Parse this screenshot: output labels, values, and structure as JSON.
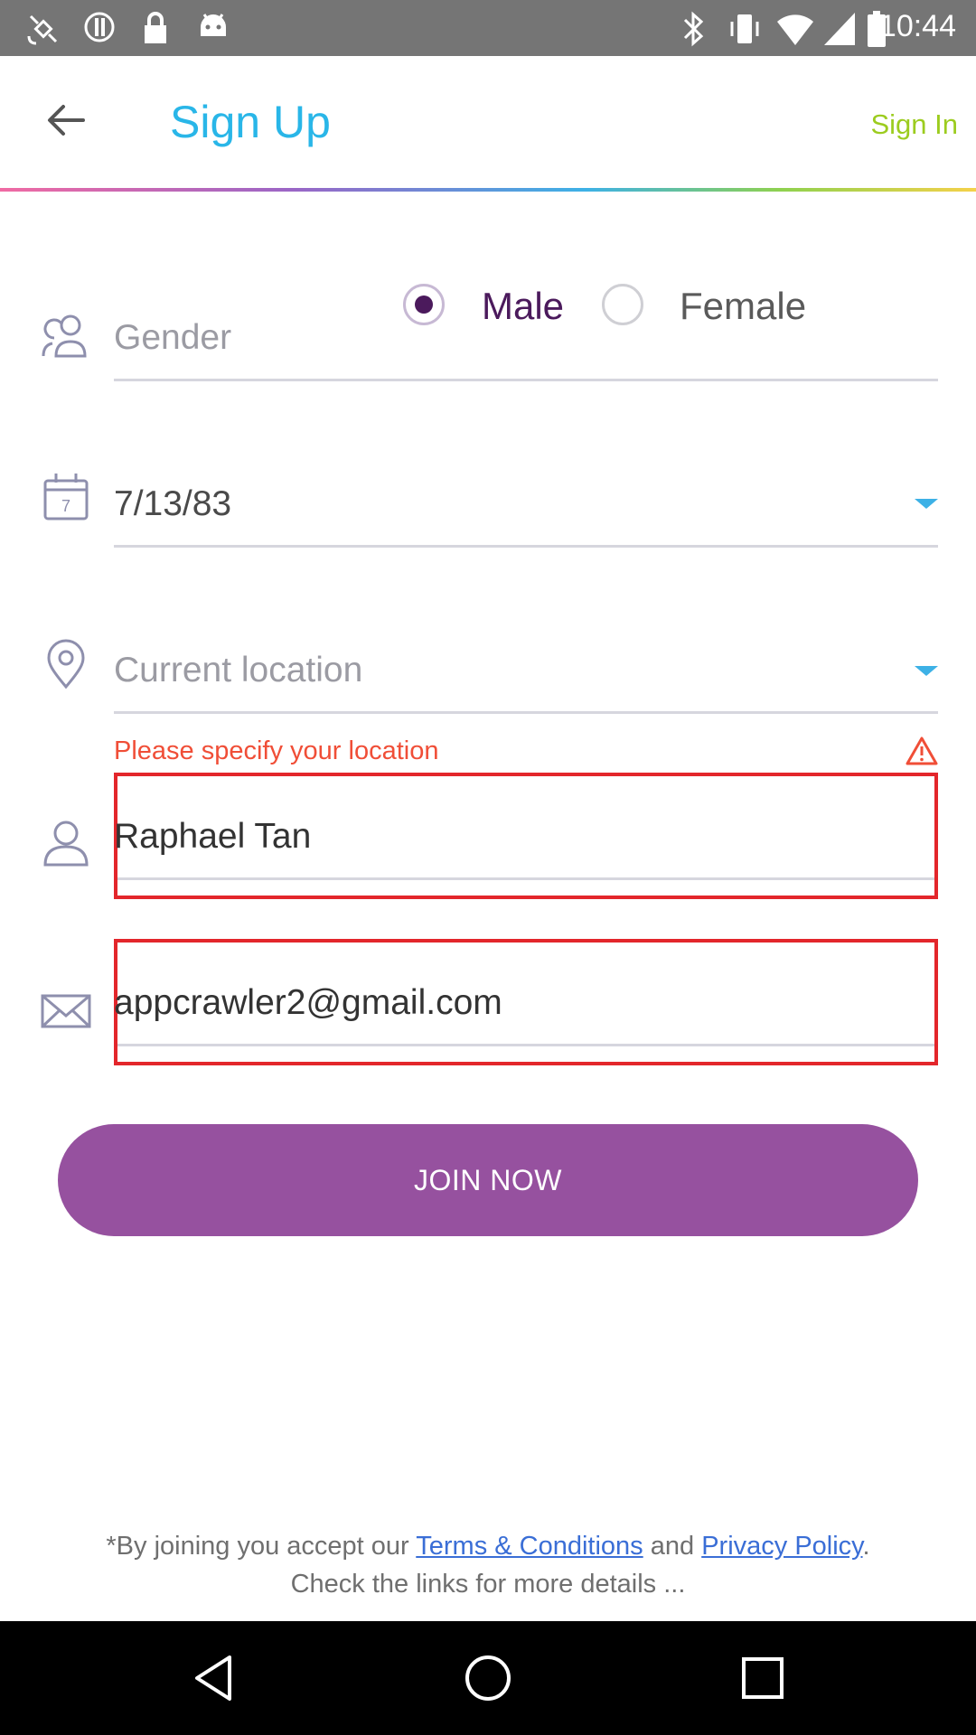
{
  "status_bar": {
    "time": "10:44"
  },
  "header": {
    "title": "Sign Up",
    "sign_in_label": "Sign In"
  },
  "form": {
    "gender": {
      "label": "Gender",
      "options": [
        {
          "label": "Male",
          "selected": true
        },
        {
          "label": "Female",
          "selected": false
        }
      ]
    },
    "birthdate": {
      "value": "7/13/83",
      "icon_day": "7"
    },
    "location": {
      "placeholder": "Current location",
      "error": "Please specify your location"
    },
    "name": {
      "value": "Raphael Tan"
    },
    "email": {
      "value": "appcrawler2@gmail.com"
    }
  },
  "join_button": {
    "label": "JOIN NOW"
  },
  "terms": {
    "prefix": "*By joining you accept our ",
    "terms_link": "Terms & Conditions",
    "middle": " and ",
    "privacy_link": "Privacy Policy",
    "suffix": ".",
    "line2": "Check the links for more details ..."
  },
  "colors": {
    "title": "#29b6e8",
    "sign_in": "#9ccc1f",
    "error": "#f04e37",
    "join_button": "#96519f",
    "radio_selected": "#4b1a5c",
    "link": "#3a6ed6"
  }
}
